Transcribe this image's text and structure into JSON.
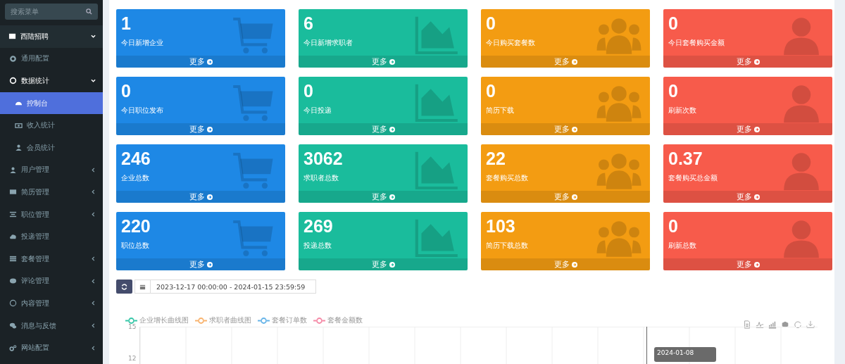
{
  "sidebar": {
    "search": {
      "placeholder": "搜索菜单"
    },
    "items": [
      {
        "label": "西陆招聘",
        "kind": "group",
        "expanded": true,
        "selected": false,
        "children": [
          {
            "label": "通用配置",
            "kind": "link",
            "selected": false
          },
          {
            "label": "数据统计",
            "kind": "group",
            "expanded": true,
            "selected": false,
            "children": [
              {
                "label": "控制台",
                "kind": "link",
                "selected": true
              },
              {
                "label": "收入统计",
                "kind": "link",
                "selected": false
              },
              {
                "label": "会员统计",
                "kind": "link",
                "selected": false
              }
            ]
          },
          {
            "label": "用户管理",
            "kind": "group",
            "expanded": false,
            "selected": false
          },
          {
            "label": "简历管理",
            "kind": "group",
            "expanded": false,
            "selected": false
          },
          {
            "label": "职位管理",
            "kind": "group",
            "expanded": false,
            "selected": false
          },
          {
            "label": "投递管理",
            "kind": "link",
            "selected": false
          },
          {
            "label": "套餐管理",
            "kind": "group",
            "expanded": false,
            "selected": false
          },
          {
            "label": "评论管理",
            "kind": "group",
            "expanded": false,
            "selected": false
          },
          {
            "label": "内容管理",
            "kind": "group",
            "expanded": false,
            "selected": false
          },
          {
            "label": "消息与反馈",
            "kind": "group",
            "expanded": false,
            "selected": false
          },
          {
            "label": "网站配置",
            "kind": "group",
            "expanded": false,
            "selected": false
          }
        ]
      }
    ]
  },
  "stat_cards": [
    {
      "value": "1",
      "label": "今日新增企业",
      "more": "更多",
      "color": "#1e88e5"
    },
    {
      "value": "6",
      "label": "今日新增求职者",
      "more": "更多",
      "color": "#1abc9c"
    },
    {
      "value": "0",
      "label": "今日购买套餐数",
      "more": "更多",
      "color": "#f39c12"
    },
    {
      "value": "0",
      "label": "今日套餐购买金额",
      "more": "更多",
      "color": "#f75b4b"
    },
    {
      "value": "0",
      "label": "今日职位发布",
      "more": "更多",
      "color": "#1e88e5"
    },
    {
      "value": "0",
      "label": "今日投递",
      "more": "更多",
      "color": "#1abc9c"
    },
    {
      "value": "0",
      "label": "简历下载",
      "more": "更多",
      "color": "#f39c12"
    },
    {
      "value": "0",
      "label": "刷新次数",
      "more": "更多",
      "color": "#f75b4b"
    },
    {
      "value": "246",
      "label": "企业总数",
      "more": "更多",
      "color": "#1e88e5"
    },
    {
      "value": "3062",
      "label": "求职者总数",
      "more": "更多",
      "color": "#1abc9c"
    },
    {
      "value": "22",
      "label": "套餐购买总数",
      "more": "更多",
      "color": "#f39c12"
    },
    {
      "value": "0.37",
      "label": "套餐购买总金额",
      "more": "更多",
      "color": "#f75b4b"
    },
    {
      "value": "220",
      "label": "职位总数",
      "more": "更多",
      "color": "#1e88e5"
    },
    {
      "value": "269",
      "label": "投递总数",
      "more": "更多",
      "color": "#1abc9c"
    },
    {
      "value": "103",
      "label": "简历下载总数",
      "more": "更多",
      "color": "#f39c12"
    },
    {
      "value": "0",
      "label": "刷新总数",
      "more": "更多",
      "color": "#f75b4b"
    }
  ],
  "date_range": {
    "value": "2023-12-17 00:00:00 - 2024-01-15 23:59:59"
  },
  "chart": {
    "legend": [
      {
        "name": "企业增长曲线图",
        "color": "#37c7a8"
      },
      {
        "name": "求职者曲线图",
        "color": "#f8b36f"
      },
      {
        "name": "套餐订单数",
        "color": "#67b4e8"
      },
      {
        "name": "套餐金额数",
        "color": "#f58aa7"
      }
    ],
    "y_labels": [
      "15",
      "12"
    ],
    "tooltip": "2024-01-08"
  }
}
